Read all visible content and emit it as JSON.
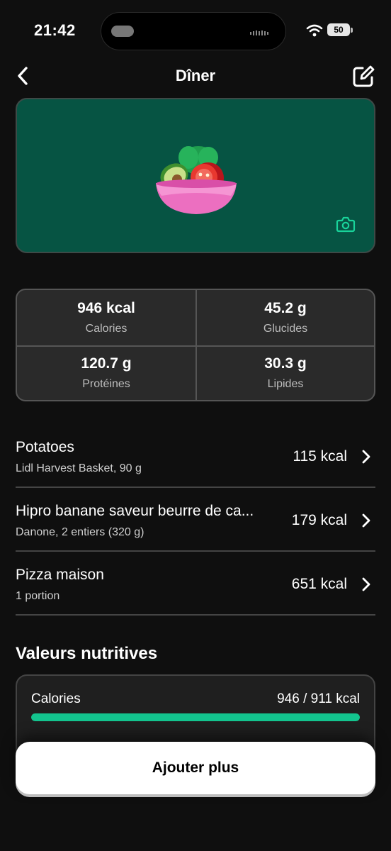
{
  "status": {
    "time": "21:42",
    "battery": "50"
  },
  "nav": {
    "title": "Dîner"
  },
  "summary": {
    "calories": {
      "value": "946 kcal",
      "label": "Calories"
    },
    "carbs": {
      "value": "45.2 g",
      "label": "Glucides"
    },
    "protein": {
      "value": "120.7 g",
      "label": "Protéines"
    },
    "fat": {
      "value": "30.3 g",
      "label": "Lipides"
    }
  },
  "foods": [
    {
      "name": "Potatoes",
      "detail": "Lidl Harvest Basket, 90 g",
      "kcal": "115 kcal"
    },
    {
      "name": "Hipro banane saveur beurre de ca...",
      "detail": "Danone, 2 entiers (320 g)",
      "kcal": "179 kcal"
    },
    {
      "name": "Pizza maison",
      "detail": "1 portion",
      "kcal": "651 kcal"
    }
  ],
  "nutrition": {
    "title": "Valeurs nutritives",
    "calories_label": "Calories",
    "calories_value": "946 / 911 kcal",
    "calories_progress": 1.0,
    "bar_color": "#13c48e"
  },
  "colors": {
    "hero_bg": "#065443",
    "accent": "#13c48e"
  },
  "icons": [
    "back-chevron-icon",
    "edit-icon",
    "salad-bowl-icon",
    "camera-icon",
    "chevron-right-icon",
    "wifi-icon"
  ],
  "add_button": "Ajouter plus"
}
